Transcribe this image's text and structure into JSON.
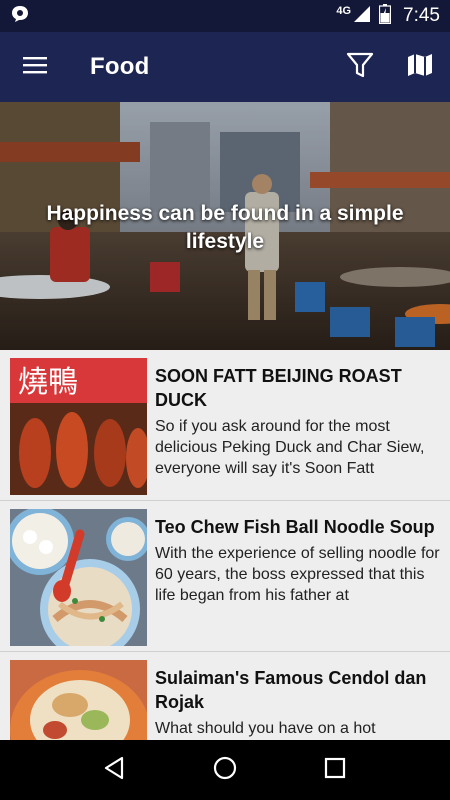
{
  "status_bar": {
    "network": "4G",
    "time": "7:45",
    "icons": [
      "notification-icon",
      "signal-icon",
      "battery-icon"
    ]
  },
  "app_bar": {
    "title": "Food",
    "icons": [
      "menu-icon",
      "filter-icon",
      "map-icon"
    ]
  },
  "hero": {
    "caption": "Happiness can be found in a simple lifestyle"
  },
  "items": [
    {
      "title": "SOON FATT BEIJING ROAST DUCK",
      "description": "So if you ask around for the most delicious Peking Duck and Char Siew, everyone will say it's Soon Fatt"
    },
    {
      "title": "Teo Chew Fish Ball Noodle Soup",
      "description": "With the experience of selling noodle for 60 years, the boss expressed that this life began from his father at"
    },
    {
      "title": "Sulaiman's Famous Cendol dan Rojak",
      "description": "What should you have on a hot"
    }
  ],
  "nav_bar": {
    "icons": [
      "back-icon",
      "home-icon",
      "recents-icon"
    ]
  },
  "colors": {
    "status_bar": "#141838",
    "app_bar": "#1d2552",
    "list_background": "#eeeeee"
  }
}
